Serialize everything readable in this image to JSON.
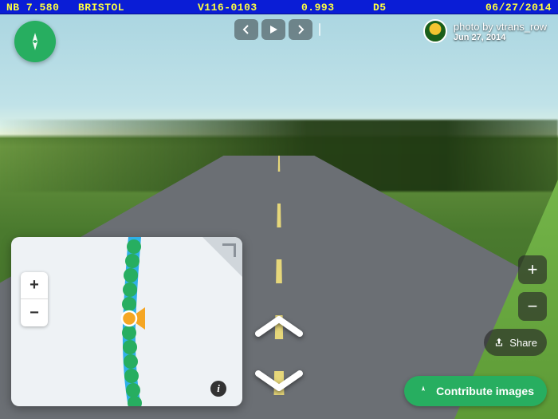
{
  "hud": {
    "nb": "NB 7.580",
    "location": "BRISTOL",
    "code": "V116-0103",
    "value": "0.993",
    "district": "D5",
    "date": "06/27/2014"
  },
  "attribution": {
    "by_label": "photo by ",
    "author": "vtrans_row",
    "date": "Jun 27, 2014"
  },
  "nav": {
    "prev_icon": "chevron-left-icon",
    "play_icon": "play-icon",
    "next_icon": "chevron-right-icon"
  },
  "buttons": {
    "share": "Share",
    "contribute": "Contribute images",
    "zoom_in": "+",
    "zoom_out": "−",
    "map_zoom_in": "+",
    "map_zoom_out": "−",
    "info": "i"
  },
  "minimap": {
    "current_bearing_deg": 20
  }
}
